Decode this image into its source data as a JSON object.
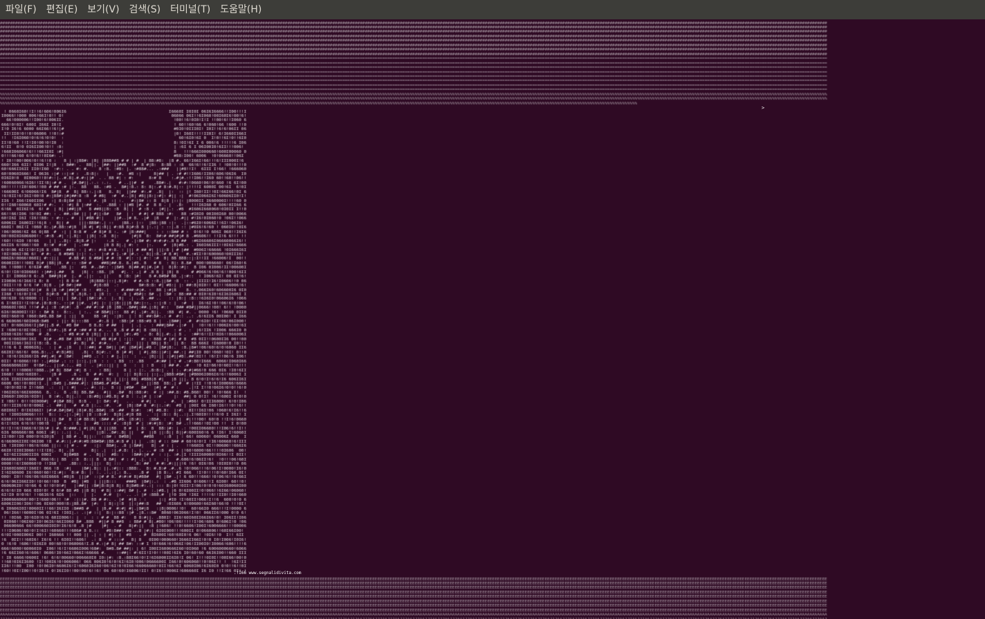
{
  "menubar": {
    "items": [
      {
        "id": "file",
        "label": "파일(F)"
      },
      {
        "id": "edit",
        "label": "편집(E)"
      },
      {
        "id": "view",
        "label": "보기(V)"
      },
      {
        "id": "search",
        "label": "검색(S)"
      },
      {
        "id": "terminal",
        "label": "터미널(T)"
      },
      {
        "id": "help",
        "label": "도움말(H)"
      }
    ]
  },
  "terminal": {
    "signature_text": ".!I66 www.segnalidivita.com",
    "prompt_arrow": ">",
    "colors": {
      "background": "#2f0a24",
      "menubar": "#3d3d39",
      "menubar_text": "#dfdbd2",
      "foreground": "#ffffff"
    }
  }
}
